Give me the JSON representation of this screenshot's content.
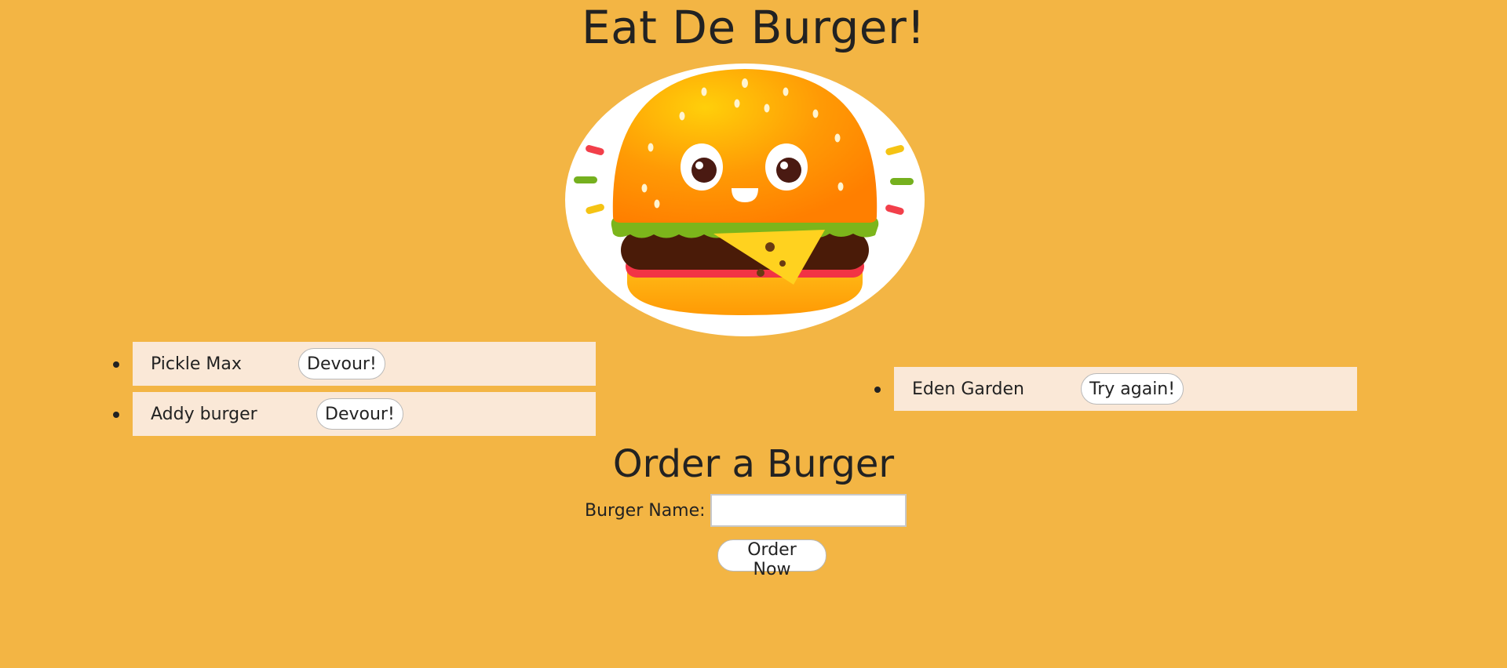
{
  "header": {
    "title": "Eat De Burger!"
  },
  "logo": {
    "icon": "burger-mascot-icon"
  },
  "uneaten_burgers": [
    {
      "name": "Pickle Max",
      "button": "Devour!"
    },
    {
      "name": "Addy burger",
      "button": "Devour!"
    }
  ],
  "devoured_burgers": [
    {
      "name": "Eden Garden",
      "button": "Try again!"
    }
  ],
  "order": {
    "title": "Order a Burger",
    "label": "Burger Name:",
    "input_value": "",
    "input_placeholder": "",
    "submit_label": "Order Now"
  },
  "colors": {
    "background": "#f3b544",
    "item_background": "#fae8d7",
    "text": "#222222"
  }
}
